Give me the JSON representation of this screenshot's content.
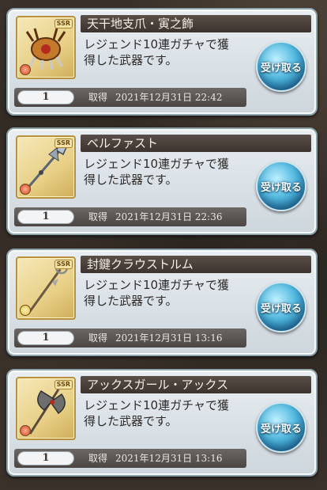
{
  "items": [
    {
      "name": "天干地支爪・寅之飾",
      "desc_line1": "レジェンド10連ガチャで獲",
      "desc_line2": "得した武器です。",
      "button": "受け取る",
      "quantity": "1",
      "acquired_label": "取得",
      "acquired_date": "2021年12月31日 22:42",
      "rarity": "SSR",
      "element_color": "#d8402a"
    },
    {
      "name": "ベルファスト",
      "desc_line1": "レジェンド10連ガチャで獲",
      "desc_line2": "得した武器です。",
      "button": "受け取る",
      "quantity": "1",
      "acquired_label": "取得",
      "acquired_date": "2021年12月31日 22:36",
      "rarity": "SSR",
      "element_color": "#d8402a"
    },
    {
      "name": "封鍵クラウストルム",
      "desc_line1": "レジェンド10連ガチャで獲",
      "desc_line2": "得した武器です。",
      "button": "受け取る",
      "quantity": "1",
      "acquired_label": "取得",
      "acquired_date": "2021年12月31日 13:16",
      "rarity": "SSR",
      "element_color": "#e2c04a"
    },
    {
      "name": "アックスガール・アックス",
      "desc_line1": "レジェンド10連ガチャで獲",
      "desc_line2": "得した武器です。",
      "button": "受け取る",
      "quantity": "1",
      "acquired_label": "取得",
      "acquired_date": "2021年12月31日 13:16",
      "rarity": "SSR",
      "element_color": "#d8402a"
    }
  ]
}
